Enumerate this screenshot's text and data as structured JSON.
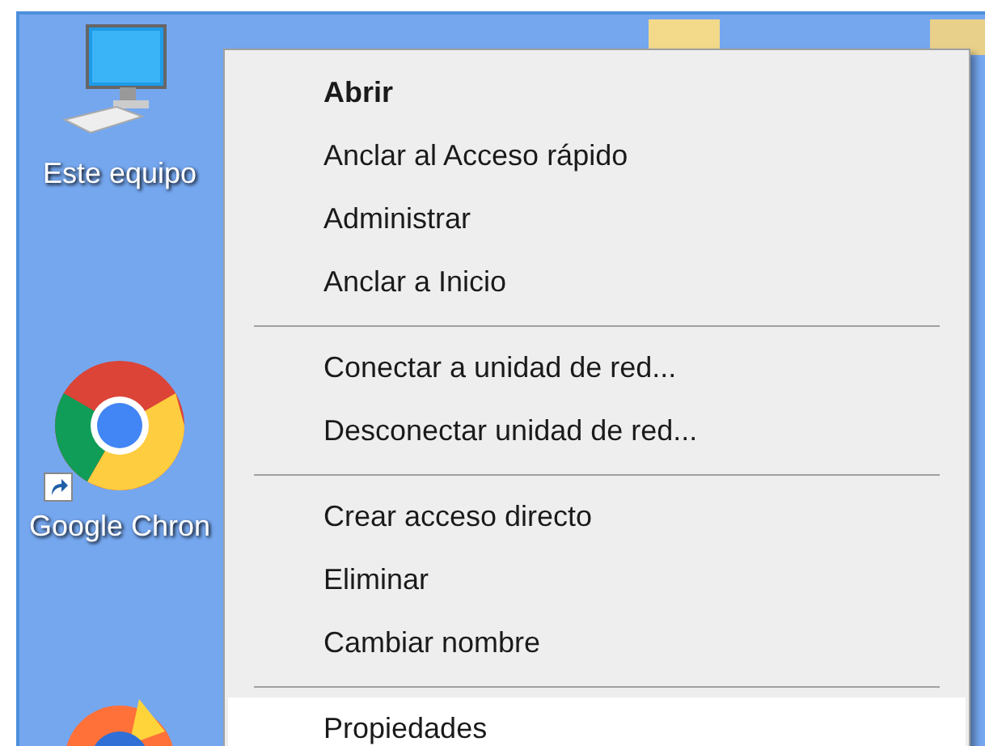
{
  "desktop_icons": [
    {
      "kind": "computer",
      "label": "Este equipo",
      "shortcut": false
    },
    {
      "kind": "chrome",
      "label": "Google Chron",
      "shortcut": true
    },
    {
      "kind": "firefox",
      "shortcut": false
    }
  ],
  "context_menu": {
    "groups": [
      {
        "items": [
          {
            "label": "Abrir",
            "default": true,
            "selected": false
          },
          {
            "label": "Anclar al Acceso rápido",
            "default": false,
            "selected": false
          },
          {
            "label": "Administrar",
            "default": false,
            "selected": false
          },
          {
            "label": "Anclar a Inicio",
            "default": false,
            "selected": false
          }
        ]
      },
      {
        "items": [
          {
            "label": "Conectar a unidad de red...",
            "default": false,
            "selected": false
          },
          {
            "label": "Desconectar unidad de red...",
            "default": false,
            "selected": false
          }
        ]
      },
      {
        "items": [
          {
            "label": "Crear acceso directo",
            "default": false,
            "selected": false
          },
          {
            "label": "Eliminar",
            "default": false,
            "selected": false
          },
          {
            "label": "Cambiar nombre",
            "default": false,
            "selected": false
          }
        ]
      },
      {
        "items": [
          {
            "label": "Propiedades",
            "default": false,
            "selected": true
          }
        ]
      }
    ]
  }
}
